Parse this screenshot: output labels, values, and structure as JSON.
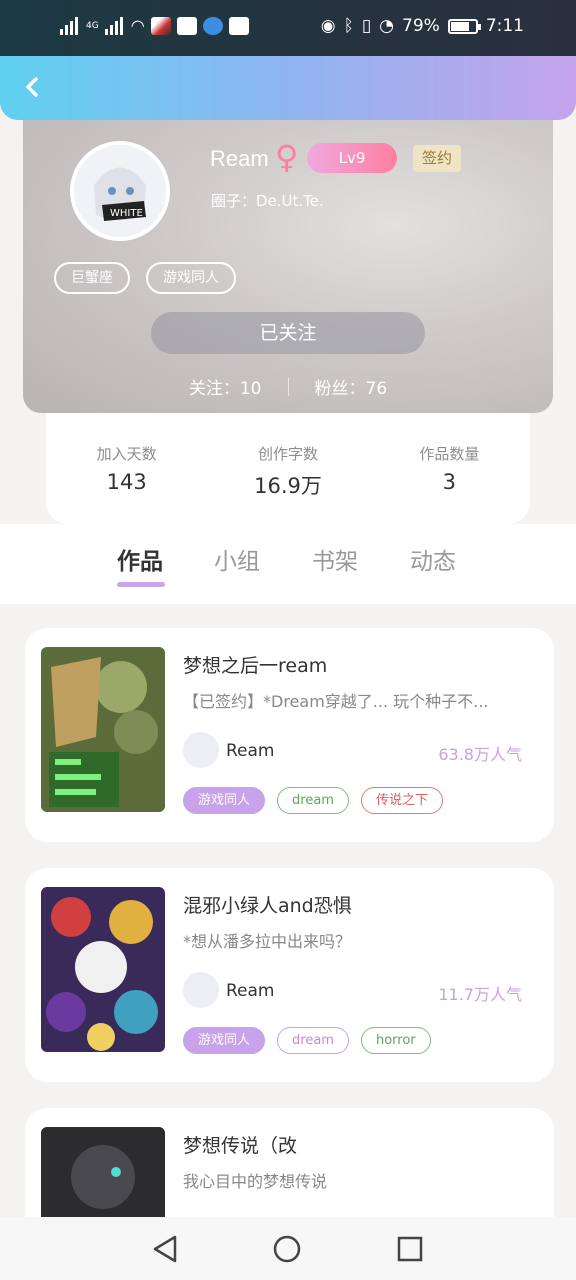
{
  "status_bar": {
    "network_label": "4G",
    "battery": "79%",
    "time": "7:11"
  },
  "profile": {
    "name": "Ream",
    "gender_symbol": "♀",
    "level": "Lv9",
    "signed_badge": "签约",
    "circle": "圈子：De.Ut.Te.",
    "tags": [
      "巨蟹座",
      "游戏同人"
    ],
    "follow_button": "已关注",
    "following": "关注：10",
    "fans": "粉丝：76"
  },
  "stats": [
    {
      "label": "加入天数",
      "value": "143"
    },
    {
      "label": "创作字数",
      "value": "16.9万"
    },
    {
      "label": "作品数量",
      "value": "3"
    }
  ],
  "tabs": [
    "作品",
    "小组",
    "书架",
    "动态"
  ],
  "works": [
    {
      "title": "梦想之后一ream",
      "desc": "【已签约】*Dream穿越了... 玩个种子不...",
      "author": "Ream",
      "popularity": "63.8万人气",
      "tags": [
        "游戏同人",
        "dream",
        "传说之下"
      ]
    },
    {
      "title": "混邪小绿人and恐惧",
      "desc": "*想从潘多拉中出来吗？",
      "author": "Ream",
      "popularity": "11.7万人气",
      "tags": [
        "游戏同人",
        "dream",
        "horror"
      ]
    },
    {
      "title": "梦想传说（改",
      "desc": "我心目中的梦想传说",
      "author": "",
      "popularity": "",
      "tags": []
    }
  ],
  "colors": {
    "accent_purple": "#c8a2ea",
    "header_start": "#5fd0f0",
    "header_end": "#c4a3ec"
  }
}
